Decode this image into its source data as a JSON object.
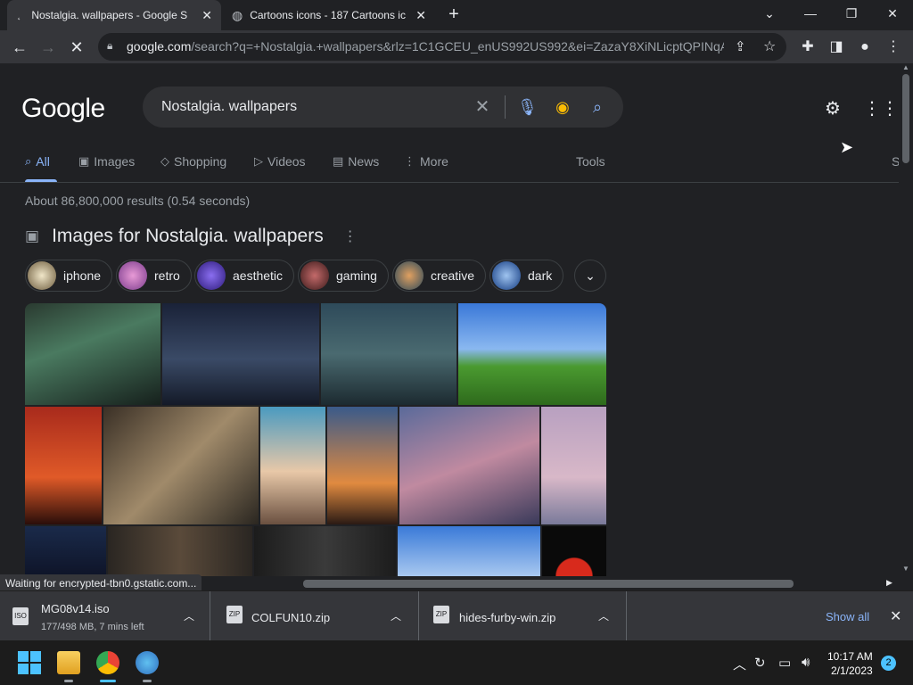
{
  "browser": {
    "tabs": [
      {
        "title": "Nostalgia. wallpapers - Google S",
        "active": true
      },
      {
        "title": "Cartoons icons - 187 Cartoons ic",
        "active": false
      }
    ],
    "new_tab_icon": "plus-icon",
    "url_main": "google.com",
    "url_rest": "/search?q=+Nostalgia.+wallpapers&rlz=1C1GCEU_enUS992US992&ei=ZazaY8XiNLicptQPINqA...",
    "status": "Waiting for encrypted-tbn0.gstatic.com..."
  },
  "google": {
    "logo": "Google",
    "query": "Nostalgia. wallpapers",
    "tabs": [
      {
        "label": "All",
        "active": true
      },
      {
        "label": "Images"
      },
      {
        "label": "Shopping"
      },
      {
        "label": "Videos"
      },
      {
        "label": "News"
      },
      {
        "label": "More"
      }
    ],
    "tools": "Tools",
    "safesearch_partial": "S",
    "stats": "About 86,800,000 results (0.54 seconds)",
    "images_title": "Images for Nostalgia. wallpapers",
    "chips": [
      "iphone",
      "retro",
      "aesthetic",
      "gaming",
      "creative",
      "dark"
    ]
  },
  "downloads": {
    "items": [
      {
        "name": "MG08v14.iso",
        "sub": "177/498 MB, 7 mins left",
        "icon": "ISO"
      },
      {
        "name": "COLFUN10.zip",
        "icon": "ZIP"
      },
      {
        "name": "hides-furby-win.zip",
        "icon": "ZIP"
      }
    ],
    "show_all": "Show all"
  },
  "taskbar": {
    "time": "10:17 AM",
    "date": "2/1/2023",
    "notifications": "2"
  },
  "colors": {
    "accent": "#8ab4f8",
    "page_bg": "#202124"
  }
}
